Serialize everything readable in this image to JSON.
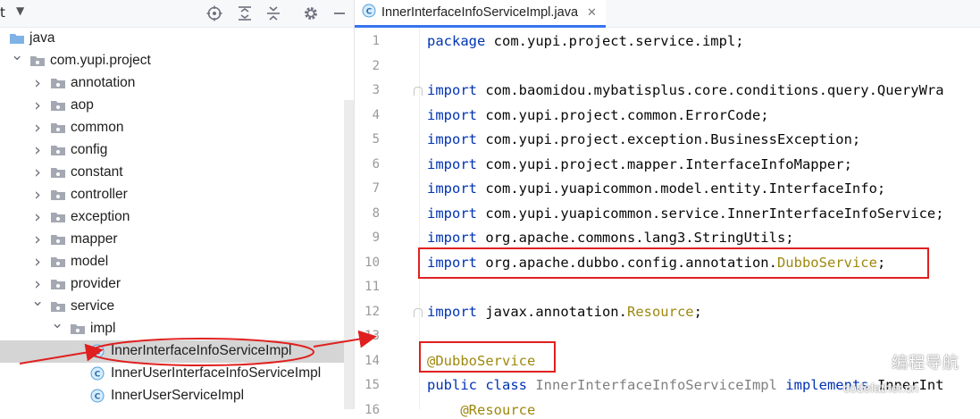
{
  "project_panel": {
    "title": "t",
    "toolbar_icons": [
      "locate-icon",
      "expand-all-icon",
      "collapse-all-icon",
      "gear-icon",
      "minimize-icon"
    ],
    "tree": [
      {
        "label": "java",
        "icon": "folder-icon",
        "arrow": ""
      },
      {
        "label": "com.yupi.project",
        "icon": "package-icon",
        "arrow": "expanded"
      },
      {
        "label": "annotation",
        "icon": "package-icon",
        "arrow": "collapsed"
      },
      {
        "label": "aop",
        "icon": "package-icon",
        "arrow": "collapsed"
      },
      {
        "label": "common",
        "icon": "package-icon",
        "arrow": "collapsed"
      },
      {
        "label": "config",
        "icon": "package-icon",
        "arrow": "collapsed"
      },
      {
        "label": "constant",
        "icon": "package-icon",
        "arrow": "collapsed"
      },
      {
        "label": "controller",
        "icon": "package-icon",
        "arrow": "collapsed"
      },
      {
        "label": "exception",
        "icon": "package-icon",
        "arrow": "collapsed"
      },
      {
        "label": "mapper",
        "icon": "package-icon",
        "arrow": "collapsed"
      },
      {
        "label": "model",
        "icon": "package-icon",
        "arrow": "collapsed"
      },
      {
        "label": "provider",
        "icon": "package-icon",
        "arrow": "collapsed"
      },
      {
        "label": "service",
        "icon": "package-icon",
        "arrow": "expanded"
      },
      {
        "label": "impl",
        "icon": "package-icon",
        "arrow": "expanded"
      },
      {
        "label": "InnerInterfaceInfoServiceImpl",
        "icon": "class-icon",
        "arrow": "",
        "selected": true
      },
      {
        "label": "InnerUserInterfaceInfoServiceImpl",
        "icon": "class-icon",
        "arrow": ""
      },
      {
        "label": "InnerUserServiceImpl",
        "icon": "class-icon",
        "arrow": ""
      }
    ]
  },
  "editor": {
    "tab": {
      "label": "InnerInterfaceInfoServiceImpl.java",
      "icon": "class-icon"
    },
    "lines": [
      {
        "num": "1",
        "segments": [
          {
            "t": "package",
            "c": "kw"
          },
          {
            "t": " com.yupi.project.service.impl;",
            "c": "plain"
          }
        ]
      },
      {
        "num": "2",
        "segments": []
      },
      {
        "num": "3",
        "segments": [
          {
            "t": "import",
            "c": "kw"
          },
          {
            "t": " com.baomidou.mybatisplus.core.conditions.query.QueryWra",
            "c": "plain"
          }
        ]
      },
      {
        "num": "4",
        "segments": [
          {
            "t": "import",
            "c": "kw"
          },
          {
            "t": " com.yupi.project.common.ErrorCode;",
            "c": "plain"
          }
        ]
      },
      {
        "num": "5",
        "segments": [
          {
            "t": "import",
            "c": "kw"
          },
          {
            "t": " com.yupi.project.exception.BusinessException;",
            "c": "plain"
          }
        ]
      },
      {
        "num": "6",
        "segments": [
          {
            "t": "import",
            "c": "kw"
          },
          {
            "t": " com.yupi.project.mapper.InterfaceInfoMapper;",
            "c": "plain"
          }
        ]
      },
      {
        "num": "7",
        "segments": [
          {
            "t": "import",
            "c": "kw"
          },
          {
            "t": " com.yupi.yuapicommon.model.entity.InterfaceInfo;",
            "c": "plain"
          }
        ]
      },
      {
        "num": "8",
        "segments": [
          {
            "t": "import",
            "c": "kw"
          },
          {
            "t": " com.yupi.yuapicommon.service.InnerInterfaceInfoService;",
            "c": "plain"
          }
        ]
      },
      {
        "num": "9",
        "segments": [
          {
            "t": "import",
            "c": "kw"
          },
          {
            "t": " org.apache.commons.lang3.StringUtils;",
            "c": "plain"
          }
        ]
      },
      {
        "num": "10",
        "segments": [
          {
            "t": "import",
            "c": "kw"
          },
          {
            "t": " org.apache.dubbo.config.annotation.",
            "c": "plain"
          },
          {
            "t": "DubboService",
            "c": "ann"
          },
          {
            "t": ";",
            "c": "plain"
          }
        ]
      },
      {
        "num": "11",
        "segments": []
      },
      {
        "num": "12",
        "segments": [
          {
            "t": "import",
            "c": "kw"
          },
          {
            "t": " javax.annotation.",
            "c": "plain"
          },
          {
            "t": "Resource",
            "c": "ann"
          },
          {
            "t": ";",
            "c": "plain"
          }
        ]
      },
      {
        "num": "13",
        "segments": []
      },
      {
        "num": "14",
        "segments": [
          {
            "t": "@DubboService",
            "c": "ann"
          }
        ]
      },
      {
        "num": "15",
        "segments": [
          {
            "t": "public class ",
            "c": "kw"
          },
          {
            "t": "InnerInterfaceInfoServiceImpl",
            "c": "cls"
          },
          {
            "t": " implements",
            "c": "kw"
          },
          {
            "t": " InnerInt",
            "c": "plain"
          }
        ]
      },
      {
        "num": "16",
        "segments": [
          {
            "t": "    @Resource",
            "c": "ann"
          }
        ]
      }
    ]
  },
  "watermark": {
    "cn": "编程导航",
    "url": "codefather.cn"
  },
  "colors": {
    "keyword": "#0033b3",
    "annotation": "#9e880d",
    "highlight_box": "#e02020",
    "tab_underline": "#3574f0",
    "selected_row": "#d5d5d5"
  }
}
